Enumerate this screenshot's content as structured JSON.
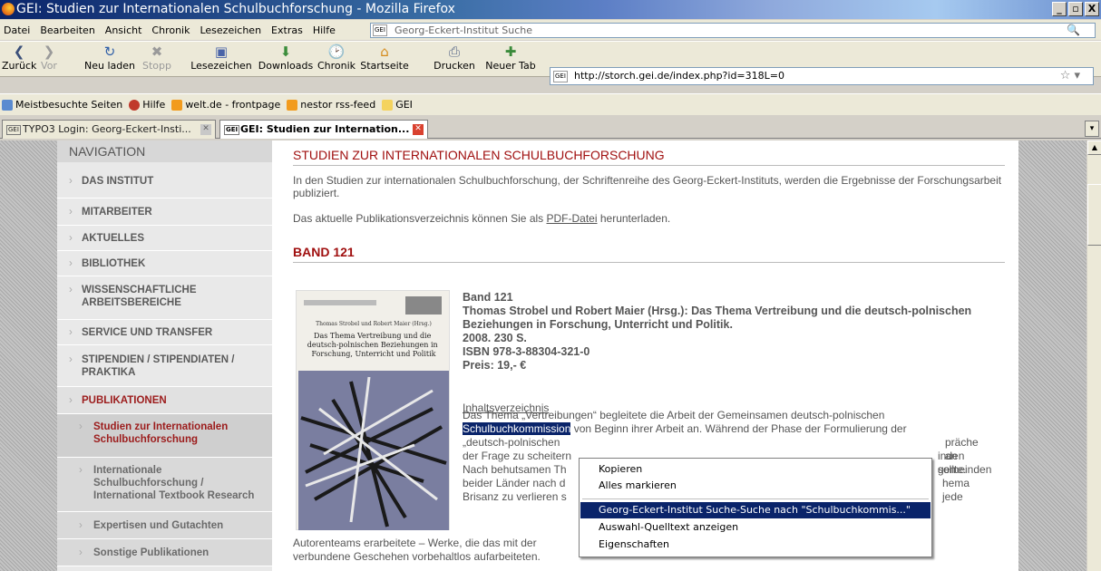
{
  "window": {
    "title": "GEI: Studien zur Internationalen Schulbuchforschung - Mozilla Firefox",
    "controls": [
      "_",
      "▫",
      "X"
    ]
  },
  "menu": [
    "Datei",
    "Bearbeiten",
    "Ansicht",
    "Chronik",
    "Lesezeichen",
    "Extras",
    "Hilfe"
  ],
  "search": {
    "engine": "GEI",
    "placeholder": "Georg-Eckert-Institut Suche"
  },
  "toolbar": {
    "back": "Zurück",
    "forward": "Vor",
    "reload": "Neu laden",
    "stop": "Stopp",
    "bookmarks": "Lesezeichen",
    "downloads": "Downloads",
    "history": "Chronik",
    "home": "Startseite",
    "print": "Drucken",
    "newtab": "Neuer Tab"
  },
  "url": {
    "site": "GEI",
    "value": "http://storch.gei.de/index.php?id=318L=0"
  },
  "bookmarks_bar": [
    "Meistbesuchte Seiten",
    "Hilfe",
    "welt.de - frontpage",
    "nestor rss-feed",
    "GEI"
  ],
  "tabs": [
    {
      "label": "TYPO3 Login: Georg-Eckert-Insti...",
      "active": false
    },
    {
      "label": "GEI: Studien zur Internation...",
      "active": true
    }
  ],
  "navigation": {
    "heading": "NAVIGATION",
    "items": [
      "DAS INSTITUT",
      "MITARBEITER",
      "AKTUELLES",
      "BIBLIOTHEK",
      "WISSENSCHAFTLICHE ARBEITSBEREICHE",
      "SERVICE UND TRANSFER",
      "STIPENDIEN / STIPENDIATEN / PRAKTIKA",
      "PUBLIKATIONEN"
    ],
    "subitems": [
      "Studien zur Internationalen Schulbuchforschung",
      "Internationale Schulbuchforschung / International Textbook Research",
      "Expertisen und Gutachten",
      "Sonstige Publikationen"
    ]
  },
  "main": {
    "title": "STUDIEN ZUR INTERNATIONALEN SCHULBUCHFORSCHUNG",
    "intro": "In den Studien zur internationalen Schulbuchforschung, der Schriftenreihe des Georg-Eckert-Instituts, werden die Ergebnisse der Forschungsarbeit publiziert.",
    "pdf_prefix": "Das aktuelle Publikationsverzeichnis können Sie als ",
    "pdf_link": "PDF-Datei",
    "pdf_suffix": " herunterladen.",
    "band_heading": "BAND 121",
    "book": {
      "band": "Band 121",
      "title": "Thomas Strobel und Robert Maier (Hrsg.): Das Thema Vertreibung und die deutsch-polnischen Beziehungen in Forschung, Unterricht und Politik.",
      "year": "2008. 230 S.",
      "isbn": "ISBN 978-3-88304-321-0",
      "price": "Preis: 19,- €",
      "cover_title": "Das Thema Vertreibung und die deutsch-polnischen Beziehungen in Forschung, Unterricht und Politik",
      "cover_authors": "Thomas Strobel und Robert Maier (Hrsg.)"
    },
    "toc_link": "Inhaltsverzeichnis",
    "body_lines": [
      "Das Thema „Vertreibungen“ begleitete die Arbeit der Gemeinsamen deutsch-polnischen",
      "Schulbuchkommission",
      " von Beginn ihrer Arbeit an. Während der Phase der Formulierung der",
      "„deutsch-polnischen",
      "präche an",
      "der Frage zu scheitern",
      "inden sollte.",
      "Nach behutsamen Th",
      "gemeinden",
      "beider Länder nach d",
      "hema jede",
      "Brisanz zu verlieren s",
      "Autorenteams erarbeitete – Werke, die das mit der",
      "verbundene Geschehen vorbehaltlos aufarbeiteten."
    ]
  },
  "context_menu": {
    "items": [
      "Kopieren",
      "Alles markieren",
      "Georg-Eckert-Institut Suche-Suche nach \"Schulbuchkommis...\"",
      "Auswahl-Quelltext anzeigen",
      "Eigenschaften"
    ]
  }
}
